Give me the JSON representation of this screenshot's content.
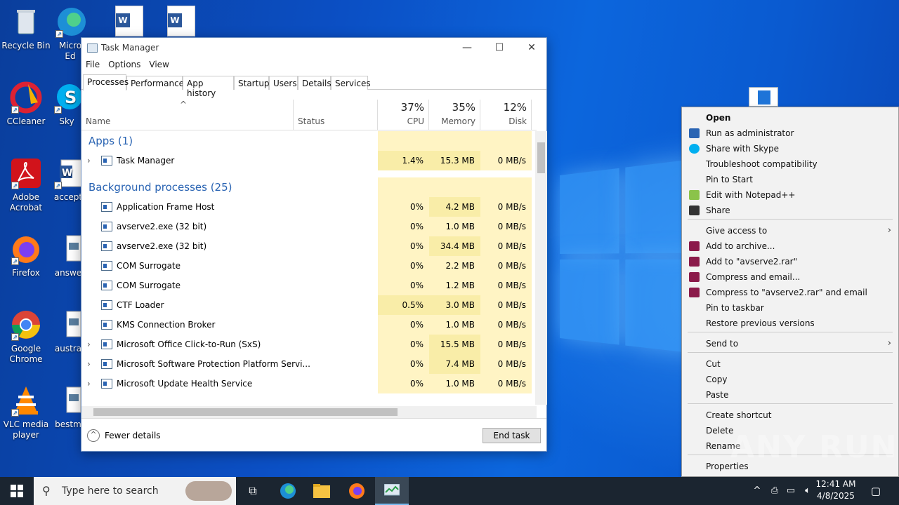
{
  "desktop": {
    "icons": [
      {
        "label": "Recycle Bin"
      },
      {
        "label": "Micro Ed"
      },
      {
        "label": "CCleaner"
      },
      {
        "label": "Sky"
      },
      {
        "label": "Adobe Acrobat"
      },
      {
        "label": "accept"
      },
      {
        "label": "Firefox"
      },
      {
        "label": "answe"
      },
      {
        "label": "Google Chrome"
      },
      {
        "label": "austra"
      },
      {
        "label": "VLC media player"
      },
      {
        "label": "bestm"
      }
    ]
  },
  "task_manager": {
    "title": "Task Manager",
    "menu": [
      "File",
      "Options",
      "View"
    ],
    "tabs": [
      "Processes",
      "Performance",
      "App history",
      "Startup",
      "Users",
      "Details",
      "Services"
    ],
    "columns": {
      "name": "Name",
      "status": "Status",
      "cpu_pct": "37%",
      "cpu": "CPU",
      "mem_pct": "35%",
      "mem": "Memory",
      "disk_pct": "12%",
      "disk": "Disk"
    },
    "groups": {
      "apps": "Apps (1)",
      "background": "Background processes (25)"
    },
    "apps": [
      {
        "name": "Task Manager",
        "cpu": "1.4%",
        "mem": "15.3 MB",
        "disk": "0 MB/s"
      }
    ],
    "background": [
      {
        "name": "Application Frame Host",
        "cpu": "0%",
        "mem": "4.2 MB",
        "disk": "0 MB/s"
      },
      {
        "name": "avserve2.exe (32 bit)",
        "cpu": "0%",
        "mem": "1.0 MB",
        "disk": "0 MB/s"
      },
      {
        "name": "avserve2.exe (32 bit)",
        "cpu": "0%",
        "mem": "34.4 MB",
        "disk": "0 MB/s"
      },
      {
        "name": "COM Surrogate",
        "cpu": "0%",
        "mem": "2.2 MB",
        "disk": "0 MB/s"
      },
      {
        "name": "COM Surrogate",
        "cpu": "0%",
        "mem": "1.2 MB",
        "disk": "0 MB/s"
      },
      {
        "name": "CTF Loader",
        "cpu": "0.5%",
        "mem": "3.0 MB",
        "disk": "0 MB/s"
      },
      {
        "name": "KMS Connection Broker",
        "cpu": "0%",
        "mem": "1.0 MB",
        "disk": "0 MB/s"
      },
      {
        "name": "Microsoft Office Click-to-Run (SxS)",
        "cpu": "0%",
        "mem": "15.5 MB",
        "disk": "0 MB/s"
      },
      {
        "name": "Microsoft Software Protection Platform Servi...",
        "cpu": "0%",
        "mem": "7.4 MB",
        "disk": "0 MB/s"
      },
      {
        "name": "Microsoft Update Health Service",
        "cpu": "0%",
        "mem": "1.0 MB",
        "disk": "0 MB/s"
      }
    ],
    "fewer_details": "Fewer details",
    "end_task": "End task"
  },
  "context_menu": {
    "items": [
      {
        "label": "Open"
      },
      {
        "label": "Run as administrator"
      },
      {
        "label": "Share with Skype"
      },
      {
        "label": "Troubleshoot compatibility"
      },
      {
        "label": "Pin to Start"
      },
      {
        "label": "Edit with Notepad++"
      },
      {
        "label": "Share"
      },
      {
        "label": "Give access to"
      },
      {
        "label": "Add to archive..."
      },
      {
        "label": "Add to \"avserve2.rar\""
      },
      {
        "label": "Compress and email..."
      },
      {
        "label": "Compress to \"avserve2.rar\" and email"
      },
      {
        "label": "Pin to taskbar"
      },
      {
        "label": "Restore previous versions"
      },
      {
        "label": "Send to"
      },
      {
        "label": "Cut"
      },
      {
        "label": "Copy"
      },
      {
        "label": "Paste"
      },
      {
        "label": "Create shortcut"
      },
      {
        "label": "Delete"
      },
      {
        "label": "Rename"
      },
      {
        "label": "Properties"
      }
    ]
  },
  "taskbar": {
    "search_placeholder": "Type here to search",
    "time": "12:41 AM",
    "date": "4/8/2025"
  },
  "watermark": "ANY RUN"
}
